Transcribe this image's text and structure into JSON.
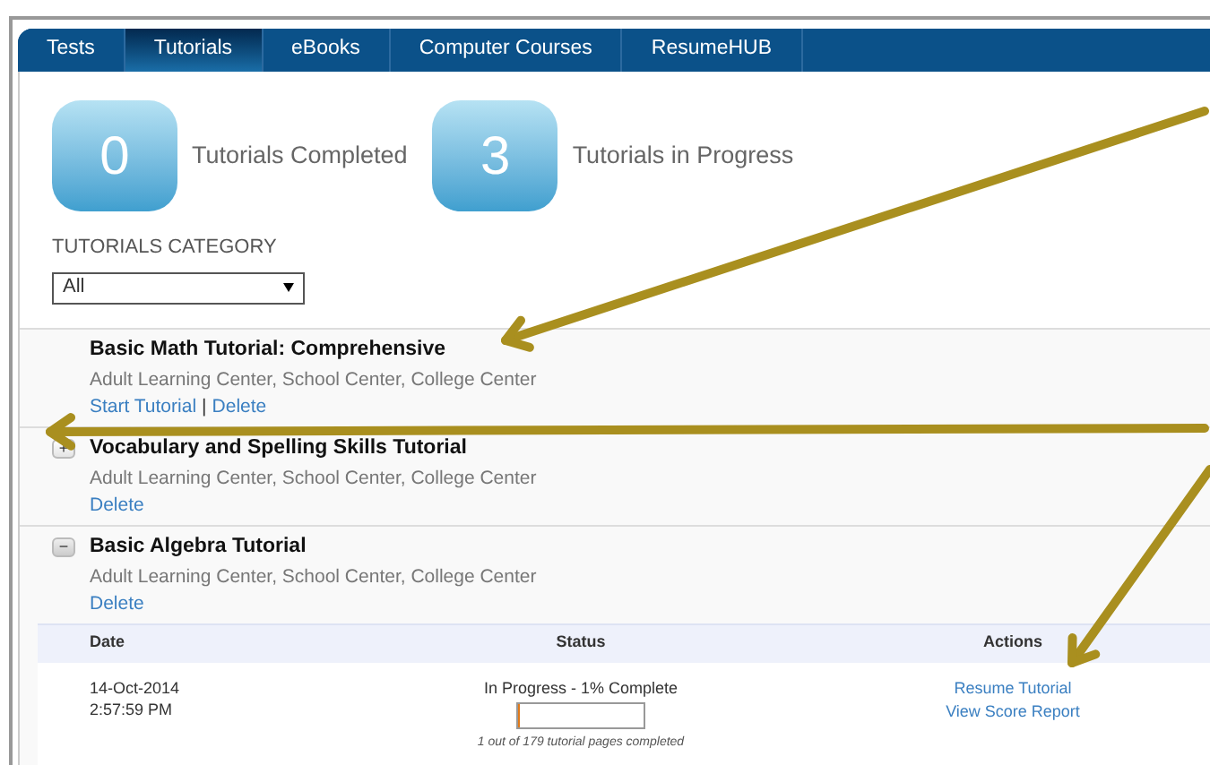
{
  "tabs": [
    {
      "label": "Tests",
      "selected": false
    },
    {
      "label": "Tutorials",
      "selected": true
    },
    {
      "label": "eBooks",
      "selected": false
    },
    {
      "label": "Computer Courses",
      "selected": false
    },
    {
      "label": "ResumeHUB",
      "selected": false
    }
  ],
  "stats": [
    {
      "count": "0",
      "label": "Tutorials Completed"
    },
    {
      "count": "3",
      "label": "Tutorials in Progress"
    }
  ],
  "category": {
    "label": "TUTORIALS CATEGORY",
    "value": "All"
  },
  "tutorials": [
    {
      "title": "Basic Math Tutorial: Comprehensive",
      "centers": "Adult Learning Center, School Center, College Center",
      "links": [
        "Start Tutorial",
        "Delete"
      ],
      "link_separator": "|"
    },
    {
      "title": "Vocabulary and Spelling Skills Tutorial",
      "centers": "Adult Learning Center, School Center, College Center",
      "toggle": {
        "symbol": "+",
        "expanded": false
      },
      "links": [
        "Delete"
      ]
    },
    {
      "title": "Basic Algebra Tutorial",
      "centers": "Adult Learning Center, School Center, College Center",
      "toggle": {
        "symbol": "−",
        "expanded": true
      },
      "links": [
        "Delete"
      ],
      "table": {
        "columns": [
          "Date",
          "Status",
          "Actions"
        ],
        "rows": [
          {
            "date": [
              "14-Oct-2014",
              "2:57:59 PM"
            ],
            "status": "In Progress - 1% Complete",
            "level": 0.01,
            "pages": "1 out of 179 tutorial pages completed",
            "actions": [
              "Resume Tutorial",
              "View Score Report"
            ]
          }
        ]
      }
    }
  ]
}
